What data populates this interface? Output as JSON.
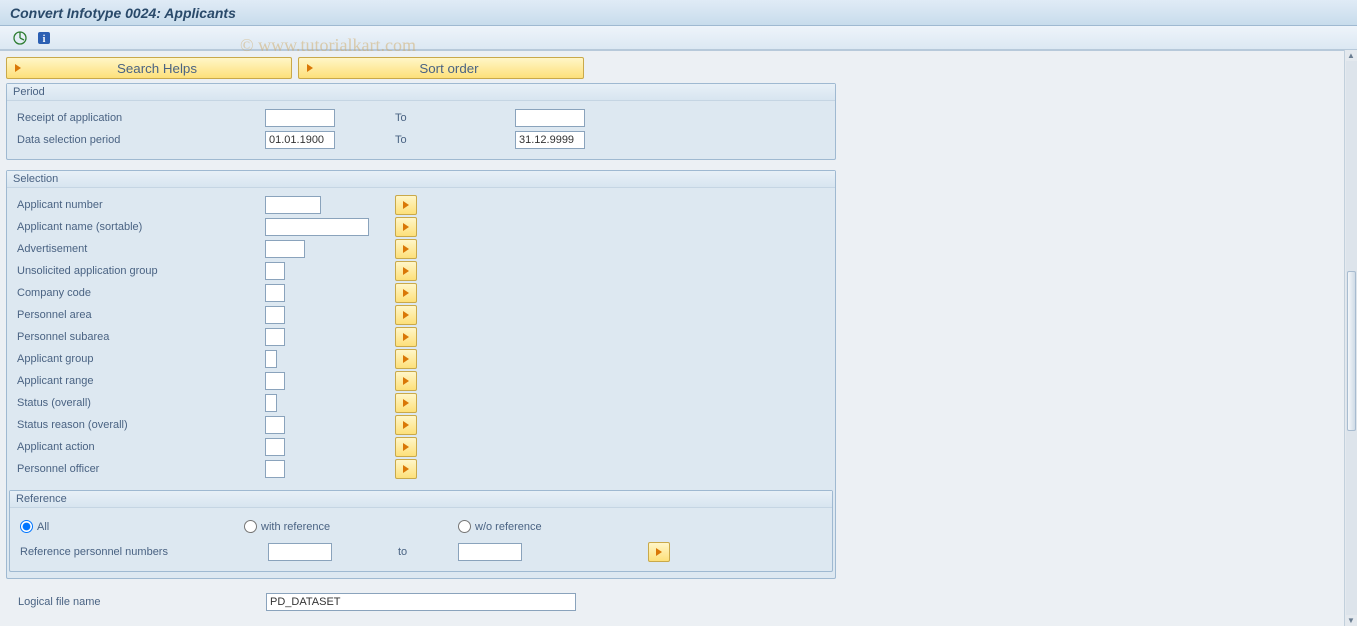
{
  "header": {
    "title": "Convert Infotype 0024: Applicants"
  },
  "watermark": "© www.tutorialkart.com",
  "top_buttons": {
    "search_helps": "Search Helps",
    "sort_order": "Sort order"
  },
  "period": {
    "legend": "Period",
    "receipt_label": "Receipt of application",
    "receipt_from": "",
    "to_label": "To",
    "receipt_to": "",
    "dsp_label": "Data selection period",
    "dsp_from": "01.01.1900",
    "dsp_to": "31.12.9999"
  },
  "selection": {
    "legend": "Selection",
    "rows": [
      {
        "label": "Applicant number",
        "value": "",
        "width": "w56"
      },
      {
        "label": "Applicant name (sortable)",
        "value": "",
        "width": "w104"
      },
      {
        "label": "Advertisement",
        "value": "",
        "width": "w40"
      },
      {
        "label": "Unsolicited application group",
        "value": "",
        "width": "w20"
      },
      {
        "label": "Company code",
        "value": "",
        "width": "w20"
      },
      {
        "label": "Personnel area",
        "value": "",
        "width": "w20"
      },
      {
        "label": "Personnel subarea",
        "value": "",
        "width": "w20"
      },
      {
        "label": "Applicant group",
        "value": "",
        "width": "w12"
      },
      {
        "label": "Applicant range",
        "value": "",
        "width": "w20"
      },
      {
        "label": "Status (overall)",
        "value": "",
        "width": "w12"
      },
      {
        "label": "Status reason (overall)",
        "value": "",
        "width": "w20"
      },
      {
        "label": "Applicant action",
        "value": "",
        "width": "w20"
      },
      {
        "label": "Personnel officer",
        "value": "",
        "width": "w20"
      }
    ]
  },
  "reference": {
    "legend": "Reference",
    "opt_all": "All",
    "opt_with": "with reference",
    "opt_wo": "w/o reference",
    "ref_pernr_label": "Reference personnel numbers",
    "ref_pernr_from": "",
    "ref_to_label": "to",
    "ref_pernr_to": ""
  },
  "logical_file": {
    "label": "Logical file name",
    "value": "PD_DATASET"
  }
}
